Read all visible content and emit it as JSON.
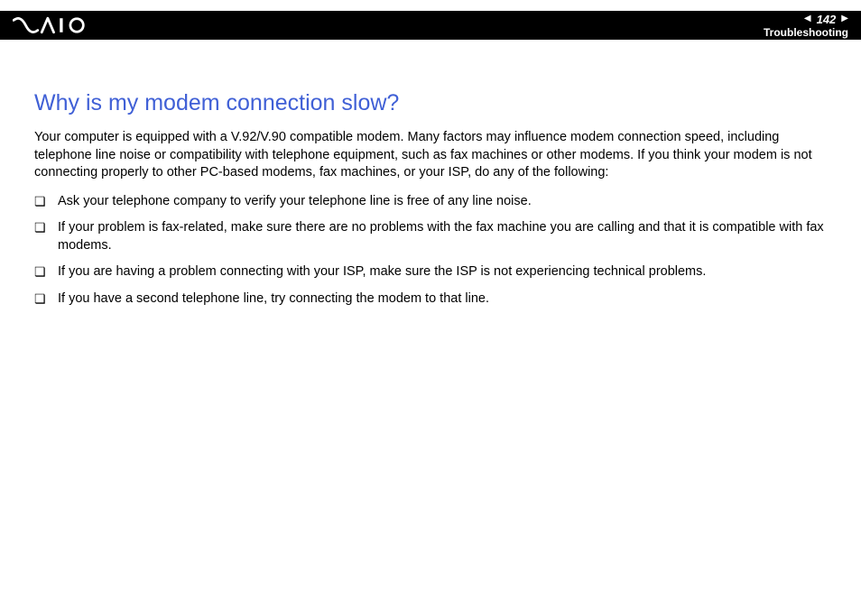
{
  "header": {
    "page_number": "142",
    "section": "Troubleshooting"
  },
  "content": {
    "title": "Why is my modem connection slow?",
    "intro": "Your computer is equipped with a V.92/V.90 compatible modem. Many factors may influence modem connection speed, including telephone line noise or compatibility with telephone equipment, such as fax machines or other modems. If you think your modem is not connecting properly to other PC-based modems, fax machines, or your ISP, do any of the following:",
    "bullets": [
      "Ask your telephone company to verify your telephone line is free of any line noise.",
      "If your problem is fax-related, make sure there are no problems with the fax machine you are calling and that it is compatible with fax modems.",
      "If you are having a problem connecting with your ISP, make sure the ISP is not experiencing technical problems.",
      "If you have a second telephone line, try connecting the modem to that line."
    ]
  }
}
